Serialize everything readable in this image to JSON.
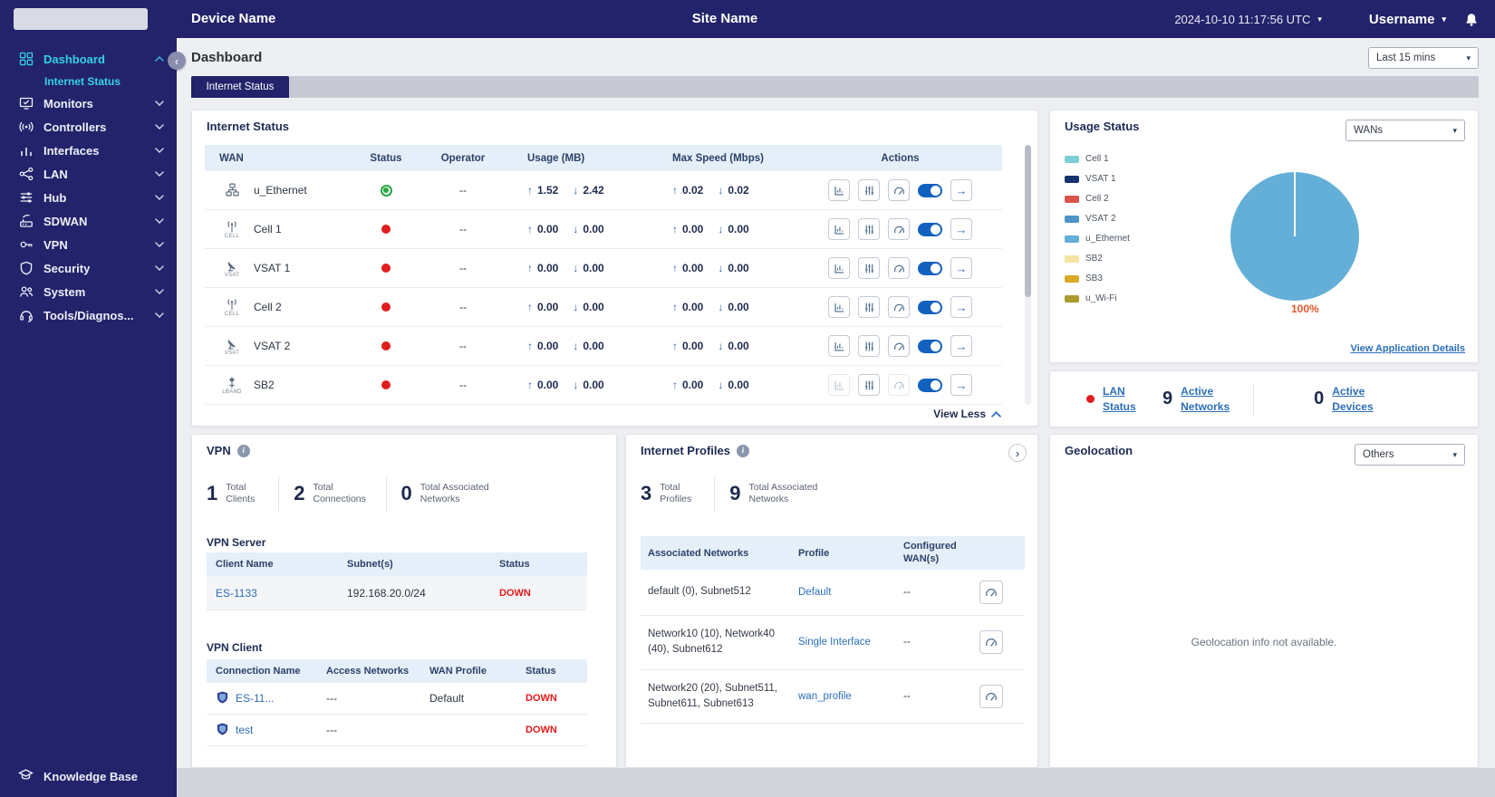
{
  "colors": {
    "topbar_navy": "#23236B",
    "accent_cyan": "#35D1E3",
    "link_blue": "#2D6FB7",
    "status_up_green": "#28A745",
    "status_down_red": "#E01E1E",
    "toggle_blue": "#1261BE",
    "table_header_blue": "#E4EFF9"
  },
  "topbar": {
    "device_name": "Device Name",
    "site_name": "Site Name",
    "timestamp": "2024-10-10 11:17:56 UTC",
    "username": "Username"
  },
  "sidebar": {
    "items": [
      {
        "label": "Dashboard"
      },
      {
        "label": "Internet Status"
      },
      {
        "label": "Monitors"
      },
      {
        "label": "Controllers"
      },
      {
        "label": "Interfaces"
      },
      {
        "label": "LAN"
      },
      {
        "label": "Hub"
      },
      {
        "label": "SDWAN"
      },
      {
        "label": "VPN"
      },
      {
        "label": "Security"
      },
      {
        "label": "System"
      },
      {
        "label": "Tools/Diagnos..."
      }
    ],
    "knowledge_base_label": "Knowledge Base"
  },
  "page": {
    "title": "Dashboard",
    "time_range": "Last 15 mins",
    "active_tab": "Internet Status"
  },
  "internet_status": {
    "title": "Internet Status",
    "columns": [
      "WAN",
      "Status",
      "Operator",
      "Usage (MB)",
      "Max Speed (Mbps)",
      "Actions"
    ],
    "rows": [
      {
        "wan": "u_Ethernet",
        "type_label": "",
        "status": "up",
        "operator": "--",
        "usage_up": "1.52",
        "usage_down": "2.42",
        "speed_up": "0.02",
        "speed_down": "0.02"
      },
      {
        "wan": "Cell 1",
        "type_label": "CELL",
        "status": "down",
        "operator": "--",
        "usage_up": "0.00",
        "usage_down": "0.00",
        "speed_up": "0.00",
        "speed_down": "0.00"
      },
      {
        "wan": "VSAT 1",
        "type_label": "VSAT",
        "status": "down",
        "operator": "--",
        "usage_up": "0.00",
        "usage_down": "0.00",
        "speed_up": "0.00",
        "speed_down": "0.00"
      },
      {
        "wan": "Cell 2",
        "type_label": "CELL",
        "status": "down",
        "operator": "--",
        "usage_up": "0.00",
        "usage_down": "0.00",
        "speed_up": "0.00",
        "speed_down": "0.00"
      },
      {
        "wan": "VSAT 2",
        "type_label": "VSAT",
        "status": "down",
        "operator": "--",
        "usage_up": "0.00",
        "usage_down": "0.00",
        "speed_up": "0.00",
        "speed_down": "0.00"
      },
      {
        "wan": "SB2",
        "type_label": "LBAND",
        "status": "down",
        "operator": "--",
        "usage_up": "0.00",
        "usage_down": "0.00",
        "speed_up": "0.00",
        "speed_down": "0.00"
      }
    ],
    "view_less_label": "View Less"
  },
  "usage_status": {
    "title": "Usage Status",
    "filter_value": "WANs",
    "legend": [
      {
        "label": "Cell 1",
        "color": "#7CCFD6"
      },
      {
        "label": "VSAT 1",
        "color": "#16336E"
      },
      {
        "label": "Cell 2",
        "color": "#D9534A"
      },
      {
        "label": "VSAT 2",
        "color": "#4D94C9"
      },
      {
        "label": "u_Ethernet",
        "color": "#63AFD8"
      },
      {
        "label": "SB2",
        "color": "#F2E3A1"
      },
      {
        "label": "SB3",
        "color": "#D9A826"
      },
      {
        "label": "u_Wi-Fi",
        "color": "#A89B2D"
      }
    ],
    "chart_data": {
      "type": "pie",
      "title": "Usage Status",
      "labels": [
        "Cell 1",
        "VSAT 1",
        "Cell 2",
        "VSAT 2",
        "u_Ethernet",
        "SB2",
        "SB3",
        "u_Wi-Fi"
      ],
      "values": [
        0,
        0,
        0,
        0,
        100,
        0,
        0,
        0
      ],
      "colors": [
        "#7CCFD6",
        "#16336E",
        "#D9534A",
        "#4D94C9",
        "#63AFD8",
        "#F2E3A1",
        "#D9A826",
        "#A89B2D"
      ],
      "annotation": "100%",
      "legend_position": "left"
    },
    "pie_label": "100%",
    "pie_label_color": "#E4572E",
    "details_link_label": "View Application Details"
  },
  "lan_summary": {
    "lan_status_label": "LAN Status",
    "active_networks_value": "9",
    "active_networks_label": "Active Networks",
    "active_devices_value": "0",
    "active_devices_label": "Active Devices"
  },
  "vpn": {
    "title": "VPN",
    "stats": [
      {
        "value": "1",
        "label": "Total Clients"
      },
      {
        "value": "2",
        "label": "Total Connections"
      },
      {
        "value": "0",
        "label": "Total Associated Networks"
      }
    ],
    "server": {
      "heading": "VPN Server",
      "columns": [
        "Client Name",
        "Subnet(s)",
        "Status"
      ],
      "rows": [
        {
          "client_name": "ES-1133",
          "subnets": "192.168.20.0/24",
          "status": "DOWN"
        }
      ]
    },
    "client": {
      "heading": "VPN Client",
      "columns": [
        "Connection Name",
        "Access Networks",
        "WAN Profile",
        "Status"
      ],
      "rows": [
        {
          "connection_name": "ES-11...",
          "access_networks": "---",
          "wan_profile": "Default",
          "status": "DOWN"
        },
        {
          "connection_name": "test",
          "access_networks": "---",
          "wan_profile": "",
          "status": "DOWN"
        }
      ]
    }
  },
  "internet_profiles": {
    "title": "Internet Profiles",
    "stats": [
      {
        "value": "3",
        "label": "Total Profiles"
      },
      {
        "value": "9",
        "label": "Total Associated Networks"
      }
    ],
    "columns": [
      "Associated Networks",
      "Profile",
      "Configured WAN(s)"
    ],
    "rows": [
      {
        "networks": "default (0), Subnet512",
        "profile": "Default",
        "wans": "--"
      },
      {
        "networks": "Network10 (10), Network40 (40), Subnet612",
        "profile": "Single Interface",
        "wans": "--"
      },
      {
        "networks": "Network20 (20), Subnet511, Subnet611, Subnet613",
        "profile": "wan_profile",
        "wans": "--"
      }
    ]
  },
  "geolocation": {
    "title": "Geolocation",
    "filter_value": "Others",
    "empty_message": "Geolocation info not available."
  }
}
